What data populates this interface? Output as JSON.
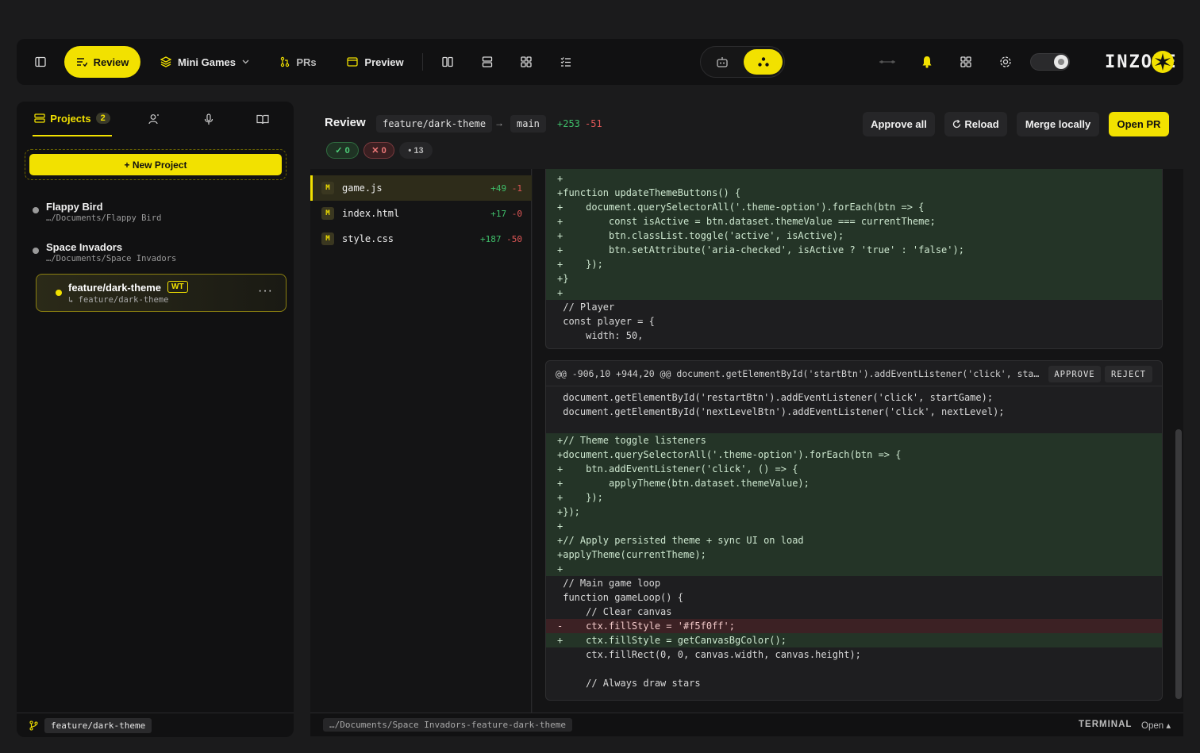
{
  "colors": {
    "accent": "#f2e100",
    "add": "#3fbf6a",
    "del": "#e05757",
    "bg": "#1b1b1c"
  },
  "topbar": {
    "review_label": "Review",
    "project_label": "Mini Games",
    "prs_label": "PRs",
    "preview_label": "Preview",
    "logo_text": "INZONE",
    "icons": [
      "sidebar-toggle-icon",
      "review-icon",
      "layers-icon",
      "chevron-down-icon",
      "pr-icon",
      "preview-icon",
      "columns-icon",
      "rows-icon",
      "grid-icon",
      "checklist-icon",
      "robot-icon",
      "nodes-icon",
      "timeline-icon",
      "bell-icon",
      "apps-icon",
      "gear-icon",
      "theme-toggle-icon",
      "logo-icon"
    ]
  },
  "sidebar": {
    "tabs": [
      {
        "label": "Projects",
        "count": "2",
        "icon": "projects-icon"
      },
      {
        "label": "",
        "icon": "user-icon"
      },
      {
        "label": "",
        "icon": "mic-icon"
      },
      {
        "label": "",
        "icon": "book-icon"
      }
    ],
    "new_project_label": "+ New Project",
    "projects": [
      {
        "name": "Flappy Bird",
        "path": "…/Documents/Flappy Bird"
      },
      {
        "name": "Space Invadors",
        "path": "…/Documents/Space Invadors"
      }
    ],
    "worktree": {
      "name": "feature/dark-theme",
      "badge": "WT",
      "path": "↳ feature/dark-theme",
      "more": "···"
    },
    "current_branch": "feature/dark-theme"
  },
  "review": {
    "title": "Review",
    "source_branch": "feature/dark-theme",
    "arrow": "→",
    "target_branch": "main",
    "additions": "+253",
    "deletions": "-51",
    "approved_count": "✓ 0",
    "rejected_count": "✕ 0",
    "pending_count": "• 13",
    "buttons": {
      "approve_all": "Approve all",
      "reload": "Reload",
      "merge_locally": "Merge locally",
      "open_pr": "Open PR"
    }
  },
  "files": [
    {
      "status": "M",
      "name": "game.js",
      "add": "+49",
      "del": "-1"
    },
    {
      "status": "M",
      "name": "index.html",
      "add": "+17",
      "del": "-0"
    },
    {
      "status": "M",
      "name": "style.css",
      "add": "+187",
      "del": "-50"
    }
  ],
  "hunks": [
    {
      "header": "",
      "lines": [
        {
          "t": "a",
          "code": "+"
        },
        {
          "t": "a",
          "code": "+function updateThemeButtons() {"
        },
        {
          "t": "a",
          "code": "+    document.querySelectorAll('.theme-option').forEach(btn => {"
        },
        {
          "t": "a",
          "code": "+        const isActive = btn.dataset.themeValue === currentTheme;"
        },
        {
          "t": "a",
          "code": "+        btn.classList.toggle('active', isActive);"
        },
        {
          "t": "a",
          "code": "+        btn.setAttribute('aria-checked', isActive ? 'true' : 'false');"
        },
        {
          "t": "a",
          "code": "+    });"
        },
        {
          "t": "a",
          "code": "+}"
        },
        {
          "t": "a",
          "code": "+"
        },
        {
          "t": "c",
          "code": " // Player"
        },
        {
          "t": "c",
          "code": " const player = {"
        },
        {
          "t": "c",
          "code": "     width: 50,"
        }
      ]
    },
    {
      "header": "@@ -906,10 +944,20 @@ document.getElementById('startBtn').addEventListener('click', startGa…",
      "approve": "APPROVE",
      "reject": "REJECT",
      "lines": [
        {
          "t": "c",
          "code": " document.getElementById('restartBtn').addEventListener('click', startGame);"
        },
        {
          "t": "c",
          "code": " document.getElementById('nextLevelBtn').addEventListener('click', nextLevel);"
        },
        {
          "t": "c",
          "code": ""
        },
        {
          "t": "a",
          "code": "+// Theme toggle listeners"
        },
        {
          "t": "a",
          "code": "+document.querySelectorAll('.theme-option').forEach(btn => {"
        },
        {
          "t": "a",
          "code": "+    btn.addEventListener('click', () => {"
        },
        {
          "t": "a",
          "code": "+        applyTheme(btn.dataset.themeValue);"
        },
        {
          "t": "a",
          "code": "+    });"
        },
        {
          "t": "a",
          "code": "+});"
        },
        {
          "t": "a",
          "code": "+"
        },
        {
          "t": "a",
          "code": "+// Apply persisted theme + sync UI on load"
        },
        {
          "t": "a",
          "code": "+applyTheme(currentTheme);"
        },
        {
          "t": "a",
          "code": "+"
        },
        {
          "t": "c",
          "code": " // Main game loop"
        },
        {
          "t": "c",
          "code": " function gameLoop() {"
        },
        {
          "t": "c",
          "code": "     // Clear canvas"
        },
        {
          "t": "d",
          "code": "-    ctx.fillStyle = '#f5f0ff';"
        },
        {
          "t": "a",
          "code": "+    ctx.fillStyle = getCanvasBgColor();"
        },
        {
          "t": "c",
          "code": "     ctx.fillRect(0, 0, canvas.width, canvas.height);"
        },
        {
          "t": "c",
          "code": ""
        },
        {
          "t": "c",
          "code": "     // Always draw stars"
        }
      ]
    }
  ],
  "bottom": {
    "path": "…/Documents/Space Invadors-feature-dark-theme",
    "terminal_label": "TERMINAL",
    "terminal_state": "Open ▴"
  }
}
